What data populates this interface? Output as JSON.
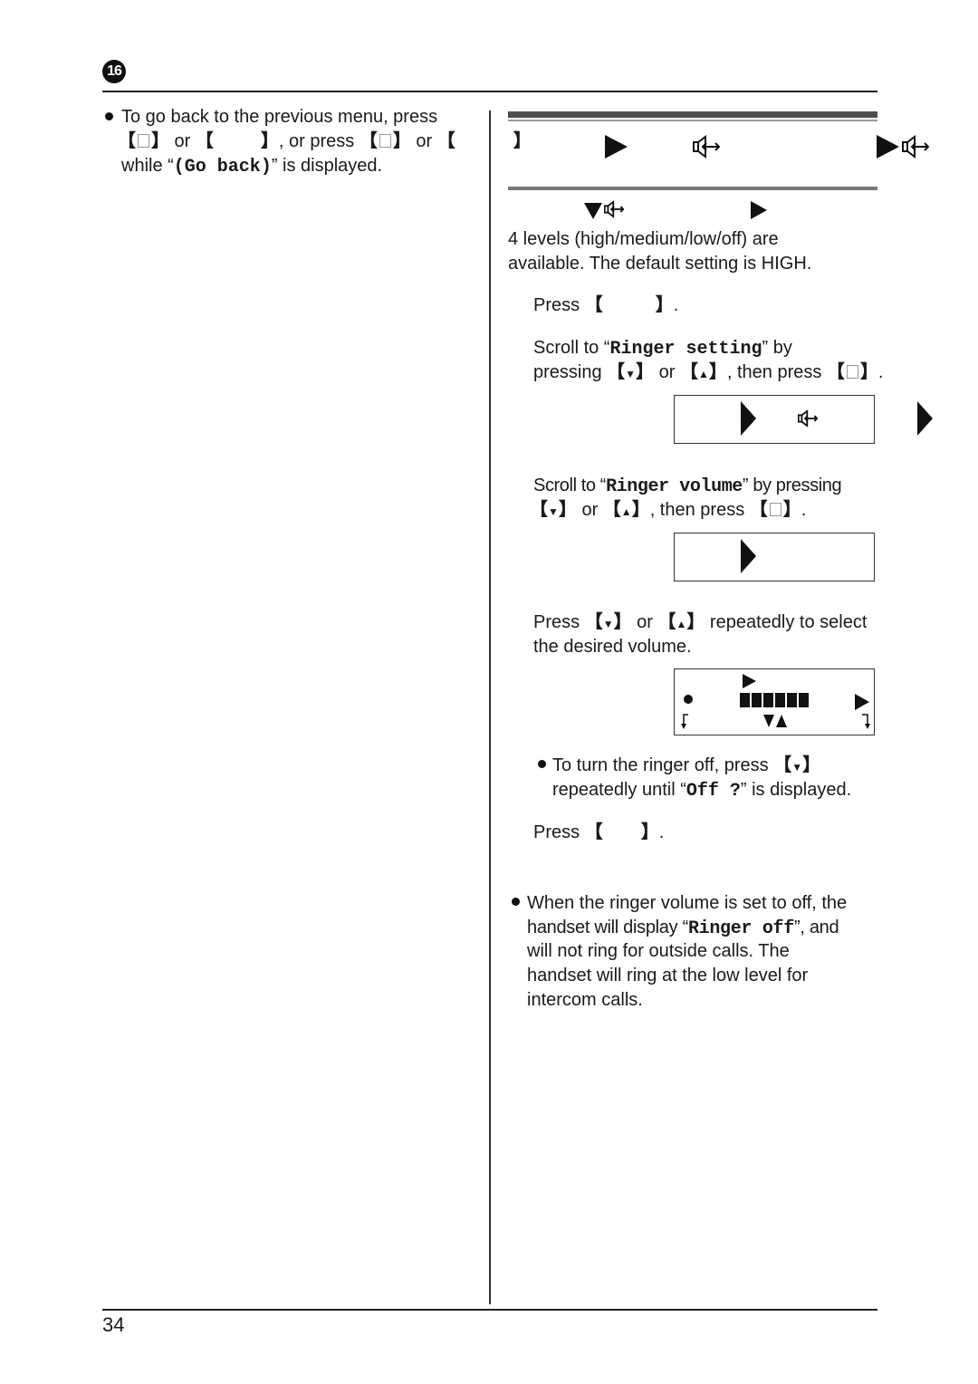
{
  "header": {
    "chapter_number": "16"
  },
  "left_column": {
    "bullet_line1": "To go back to the previous menu, press",
    "bullet_line2_or1": " or ",
    "bullet_line2_mid": ", or press ",
    "bullet_line2_or2": " or ",
    "bullet_line3_pre": "while “",
    "bullet_line3_code": "(Go back)",
    "bullet_line3_post": "” is displayed."
  },
  "right_column": {
    "intro_line1": "4 levels (high/medium/low/off) are",
    "intro_line2": "available. The default setting is HIGH.",
    "step1": {
      "prefix": "Press ",
      "suffix": "."
    },
    "step2": {
      "line1_pre": "Scroll to “",
      "line1_code": "Ringer setting",
      "line1_post": "” by",
      "line2_pre": "pressing ",
      "key_down": "▼",
      "or": " or ",
      "key_up": "▲",
      "line2_mid": ", then press ",
      "line2_end": "."
    },
    "step3": {
      "line1_pre": "Scroll to “",
      "line1_code": "Ringer volume",
      "line1_post": "” by pressing",
      "key_down": "▼",
      "or": " or ",
      "key_up": "▲",
      "line2_mid": ", then press ",
      "line2_end": "."
    },
    "step4": {
      "line1_pre": "Press ",
      "key_down": "▼",
      "or": " or ",
      "key_up": "▲",
      "line1_post": " repeatedly to select",
      "line2": "the desired volume.",
      "volume_level_bars": 6
    },
    "step4_note": {
      "line1_pre": "To turn the ringer off, press ",
      "key_down": "▼",
      "line2_pre": "repeatedly until “",
      "line2_code": "Off ?",
      "line2_post": "” is displayed."
    },
    "step5": {
      "prefix": "Press ",
      "suffix": "."
    },
    "note": {
      "line1": "When the ringer volume is set to off, the",
      "line2_pre": "handset will display “",
      "line2_code": "Ringer off",
      "line2_post": "”, and",
      "line3": "will not ring for outside calls. The",
      "line4": "handset will ring at the low level for",
      "line5": "intercom calls."
    }
  },
  "footer": {
    "page_number": "34"
  }
}
